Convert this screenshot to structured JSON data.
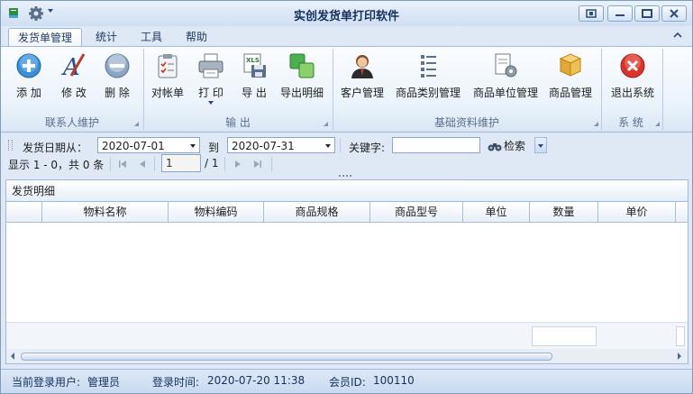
{
  "window": {
    "title": "实创发货单打印软件"
  },
  "tabs": [
    "发货单管理",
    "统计",
    "工具",
    "帮助"
  ],
  "ribbon": {
    "groups": [
      {
        "label": "联系人维护",
        "buttons": [
          "添 加",
          "修 改",
          "删 除"
        ]
      },
      {
        "label": "输 出",
        "buttons": [
          "对帐单",
          "打 印",
          "导 出",
          "导出明细"
        ]
      },
      {
        "label": "基础资料维护",
        "buttons": [
          "客户管理",
          "商品类别管理",
          "商品单位管理",
          "商品管理"
        ]
      },
      {
        "label": "系 统",
        "buttons": [
          "退出系统"
        ]
      }
    ],
    "icons": {
      "add": "add-circle-icon",
      "edit": "edit-pen-icon",
      "delete": "remove-circle-icon",
      "statement": "clipboard-checklist-icon",
      "print": "printer-icon",
      "export": "xls-save-icon",
      "export_detail": "green-squares-icon",
      "customer": "user-icon",
      "category": "list-icon",
      "unit": "document-gear-icon",
      "product": "boxes-icon",
      "exit": "close-circle-icon"
    }
  },
  "filter": {
    "date_from_label": "发货日期从：",
    "date_from": "2020-07-01",
    "date_to_label": "到",
    "date_to": "2020-07-31",
    "keyword_label": "关键字:",
    "keyword_value": "",
    "search_label": "检索"
  },
  "pager": {
    "info": "显示 1 - 0，共 0 条",
    "current_page": "1",
    "total": "/ 1"
  },
  "grid": {
    "title": "发货明细",
    "columns": [
      "物料名称",
      "物料编码",
      "商品规格",
      "商品型号",
      "单位",
      "数量",
      "单价"
    ]
  },
  "status": {
    "user_label": "当前登录用户:",
    "user": "管理员",
    "login_label": "登录时间:",
    "login_time": "2020-07-20 11:38",
    "member_label": "会员ID:",
    "member_id": "100110"
  },
  "colors": {
    "accent": "#15305d",
    "ribbon_border": "#9fb9da",
    "add": "#3a8fd8",
    "exit": "#d9332b"
  }
}
